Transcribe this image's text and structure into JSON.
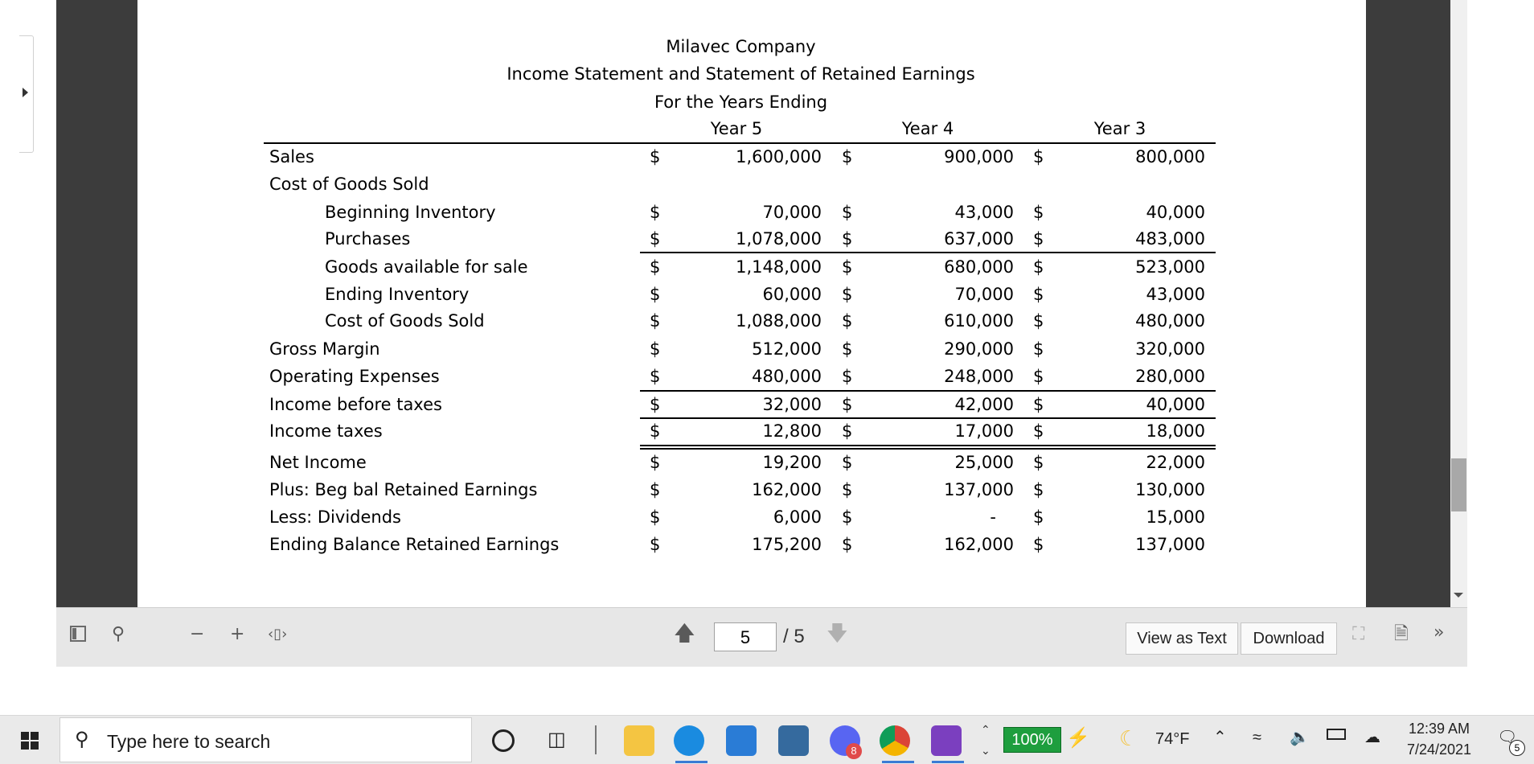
{
  "statement": {
    "company": "Milavec Company",
    "title": "Income Statement and Statement of Retained Earnings",
    "period": "For the Years Ending",
    "years": [
      "Year 5",
      "Year 4",
      "Year 3"
    ],
    "currency_symbol": "$",
    "rows": [
      {
        "label": "Sales",
        "y5": "1,600,000",
        "y4": "900,000",
        "y3": "800,000"
      },
      {
        "label": "Cost of Goods Sold"
      },
      {
        "label": "Beginning Inventory",
        "y5": "70,000",
        "y4": "43,000",
        "y3": "40,000"
      },
      {
        "label": "Purchases",
        "y5": "1,078,000",
        "y4": "637,000",
        "y3": "483,000"
      },
      {
        "label": "Goods available for sale",
        "y5": "1,148,000",
        "y4": "680,000",
        "y3": "523,000"
      },
      {
        "label": "Ending Inventory",
        "y5": "60,000",
        "y4": "70,000",
        "y3": "43,000"
      },
      {
        "label": "Cost of Goods Sold",
        "y5": "1,088,000",
        "y4": "610,000",
        "y3": "480,000"
      },
      {
        "label": "Gross Margin",
        "y5": "512,000",
        "y4": "290,000",
        "y3": "320,000"
      },
      {
        "label": "Operating Expenses",
        "y5": "480,000",
        "y4": "248,000",
        "y3": "280,000"
      },
      {
        "label": "Income before taxes",
        "y5": "32,000",
        "y4": "42,000",
        "y3": "40,000"
      },
      {
        "label": "Income taxes",
        "y5": "12,800",
        "y4": "17,000",
        "y3": "18,000"
      },
      {
        "label": "Net Income",
        "y5": "19,200",
        "y4": "25,000",
        "y3": "22,000"
      },
      {
        "label": "Plus: Beg bal Retained Earnings",
        "y5": "162,000",
        "y4": "137,000",
        "y3": "130,000"
      },
      {
        "label": "Less: Dividends",
        "y5": "6,000",
        "y4": "-",
        "y3": "15,000"
      },
      {
        "label": "Ending Balance Retained Earnings",
        "y5": "175,200",
        "y4": "162,000",
        "y3": "137,000"
      }
    ]
  },
  "toolbar": {
    "current_page": "5",
    "total_pages": "/ 5",
    "view_as_text": "View as Text",
    "download": "Download"
  },
  "taskbar": {
    "search_placeholder": "Type here to search",
    "discord_badge": "8",
    "zoom": "100%",
    "weather": "74°F",
    "time": "12:39 AM",
    "date": "7/24/2021",
    "notifications": "5"
  }
}
